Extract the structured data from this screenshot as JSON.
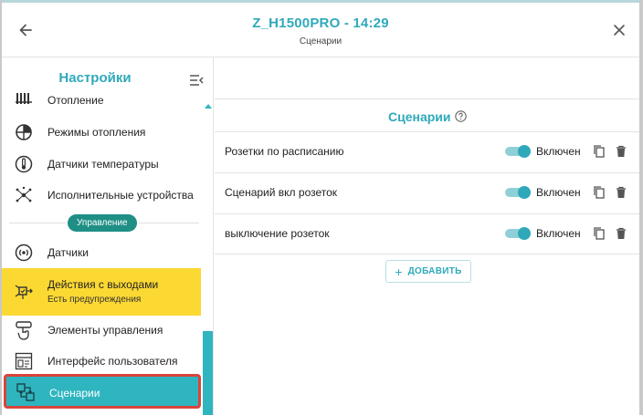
{
  "header": {
    "title": "Z_H1500PRO - 14:29",
    "subtitle": "Сценарии"
  },
  "sidebar": {
    "title": "Настройки",
    "items_top": [
      {
        "label": "Отопление",
        "icon": "radiator-icon"
      },
      {
        "label": "Режимы отопления",
        "icon": "heating-modes-icon"
      },
      {
        "label": "Датчики температуры",
        "icon": "thermometer-icon"
      },
      {
        "label": "Исполнительные устройства",
        "icon": "actuators-icon"
      }
    ],
    "section_label": "Управление",
    "items_bottom": [
      {
        "label": "Датчики",
        "icon": "sensor-icon"
      },
      {
        "label": "Действия с выходами",
        "sublabel": "Есть предупреждения",
        "icon": "outputs-actions-icon",
        "highlight": "warning"
      },
      {
        "label": "Элементы управления",
        "icon": "controls-icon"
      },
      {
        "label": "Интерфейс пользователя",
        "icon": "user-interface-icon"
      },
      {
        "label": "Сценарии",
        "icon": "scenarios-icon",
        "active": true
      }
    ]
  },
  "main": {
    "panel_title": "Сценарии",
    "scenarios": [
      {
        "name": "Розетки по расписанию",
        "status": "Включен",
        "enabled": true
      },
      {
        "name": "Сценарий вкл розеток",
        "status": "Включен",
        "enabled": true
      },
      {
        "name": "выключение розеток",
        "status": "Включен",
        "enabled": true
      }
    ],
    "add_button_label": "ДОБАВИТЬ"
  },
  "colors": {
    "accent": "#2fa9ba",
    "warning": "#fcd833",
    "section_chip": "#1f8f86",
    "active_border": "#d9443a"
  }
}
